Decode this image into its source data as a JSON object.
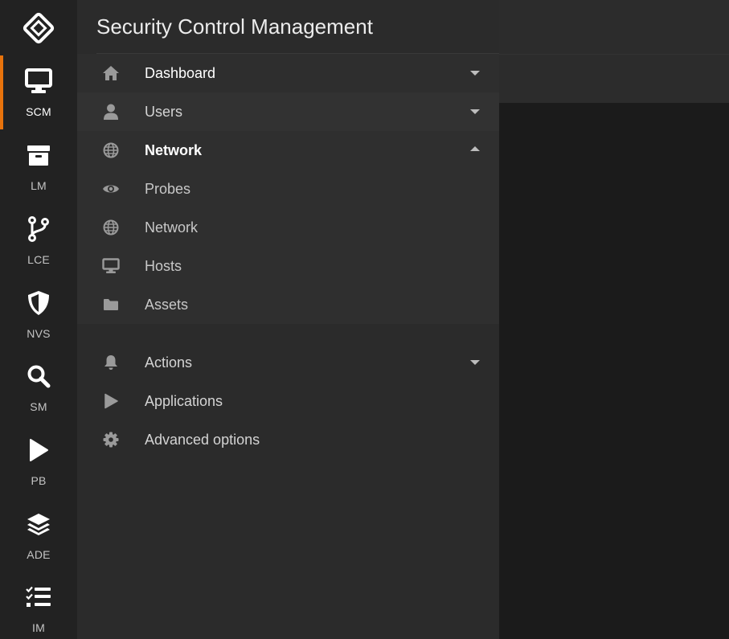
{
  "app": {
    "title": "Security Control Management",
    "accent_color": "#e8730c",
    "logo_icon": "diamond-logo-icon"
  },
  "rail": {
    "items": [
      {
        "label": "SCM",
        "icon": "monitor-icon",
        "active": true
      },
      {
        "label": "LM",
        "icon": "archive-box-icon",
        "active": false
      },
      {
        "label": "LCE",
        "icon": "code-branch-icon",
        "active": false
      },
      {
        "label": "NVS",
        "icon": "shield-icon",
        "active": false
      },
      {
        "label": "SM",
        "icon": "search-icon",
        "active": false
      },
      {
        "label": "PB",
        "icon": "play-icon",
        "active": false
      },
      {
        "label": "ADE",
        "icon": "layers-icon",
        "active": false
      },
      {
        "label": "IM",
        "icon": "checklist-icon",
        "active": false
      }
    ]
  },
  "nav": {
    "items": [
      {
        "label": "Dashboard",
        "icon": "home-icon",
        "state": "collapsed"
      },
      {
        "label": "Users",
        "icon": "user-icon",
        "state": "collapsed"
      },
      {
        "label": "Network",
        "icon": "globe-icon",
        "state": "expanded",
        "children": [
          {
            "label": "Probes",
            "icon": "eye-icon"
          },
          {
            "label": "Network",
            "icon": "globe-icon"
          },
          {
            "label": "Hosts",
            "icon": "desktop-icon"
          },
          {
            "label": "Assets",
            "icon": "folder-icon"
          }
        ]
      },
      {
        "label": "Actions",
        "icon": "bell-icon",
        "state": "collapsed"
      },
      {
        "label": "Applications",
        "icon": "play-icon"
      },
      {
        "label": "Advanced options",
        "icon": "gear-icon"
      }
    ]
  }
}
